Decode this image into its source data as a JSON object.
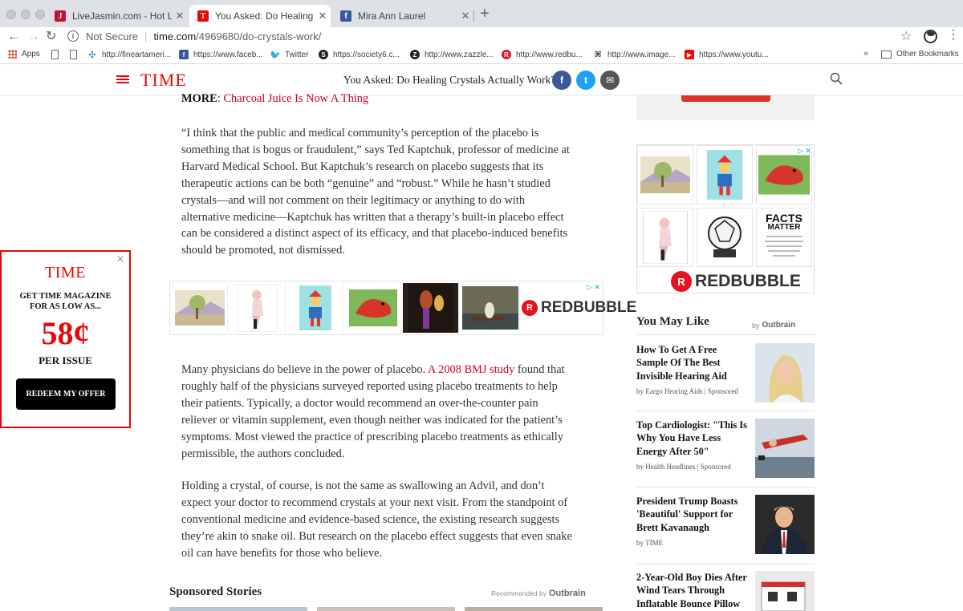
{
  "browser": {
    "tabs": [
      {
        "title": "LiveJasmin.com - Hot Live Sex",
        "favicon": "J",
        "favicon_color": "#c8102e"
      },
      {
        "title": "You Asked: Do Healing Crystals Actually Work?",
        "favicon": "T",
        "favicon_color": "#e90606"
      },
      {
        "title": "Mira Ann Laurel",
        "favicon": "f",
        "favicon_color": "#3b5998"
      }
    ],
    "url": {
      "security": "Not Secure",
      "host": "time.com",
      "path": "/4969680/do-crystals-work/"
    },
    "bookmarks": [
      {
        "label": "Apps",
        "icon": "apps-grid-icon"
      },
      {
        "label": "",
        "icon": "document-icon"
      },
      {
        "label": "",
        "icon": "document-icon"
      },
      {
        "label": "http://fineartameri...",
        "icon": "fineart-icon"
      },
      {
        "label": "https://www.faceb...",
        "icon": "facebook-icon"
      },
      {
        "label": "Twitter",
        "icon": "twitter-icon"
      },
      {
        "label": "https://society6.c...",
        "icon": "society6-icon"
      },
      {
        "label": "http://www.zazzle...",
        "icon": "zazzle-icon"
      },
      {
        "label": "http://www.redbu...",
        "icon": "redbubble-icon"
      },
      {
        "label": "http://www.image...",
        "icon": "imagekind-icon"
      },
      {
        "label": "https://www.youtu...",
        "icon": "youtube-icon"
      }
    ],
    "overflow": "»",
    "other_bookmarks": "Other Bookmarks"
  },
  "header": {
    "logo": "TIME",
    "title": "You Asked: Do Healing Crystals Actually Work?",
    "share": {
      "facebook": "f",
      "twitter": "t",
      "email": "✉"
    },
    "colors": {
      "facebook": "#3b5998",
      "twitter": "#1da1f2",
      "email": "#555555",
      "brand": "#e90606"
    }
  },
  "article": {
    "more_label": "MORE",
    "more_link": "Charcoal Juice Is Now A Thing",
    "p1": "“I think that the public and medical community’s perception of the placebo is something that is bogus or fraudulent,” says Ted Kaptchuk, professor of medicine at Harvard Medical School. But Kaptchuk’s research on placebo suggests that its therapeutic actions can be both “genuine” and “robust.” While he hasn’t studied crystals—and will not comment on their legitimacy or anything to do with alternative medicine—Kaptchuk has written that a therapy’s built-in placebo effect can be considered a distinct aspect of its efficacy, and that placebo-induced benefits should be promoted, not dismissed.",
    "p2_lead": "Many physicians do believe in the power of placebo. ",
    "p2_link": "A 2008 BMJ study",
    "p2_rest": " found that roughly half of the physicians surveyed reported using placebo treatments to help their patients. Typically, a doctor would recommend an over-the-counter pain reliever or vitamin supplement, even though neither was indicated for the patient’s symptoms. Most viewed the practice of prescribing placebo treatments as ethically permissible, the authors concluded.",
    "p3": "Holding a crystal, of course, is not the same as swallowing an Advil, and don’t expect your doctor to recommend crystals at your next visit. From the standpoint of conventional medicine and evidence-based science, the existing research suggests they’re akin to snake oil. But research on the placebo effect suggests that even snake oil can have benefits for those who believe.",
    "sponsored_title": "Sponsored Stories",
    "recommended_by": "Recommended by",
    "outbrain": "Outbrain"
  },
  "ads": {
    "redbubble": "REDBUBBLE",
    "redbubble_mark": "R",
    "adchoices": "▷ ✕",
    "facts_title": "FACTS",
    "facts_sub": "MATTER"
  },
  "promo": {
    "logo": "TIME",
    "line1": "GET TIME MAGAZINE",
    "line2": "FOR AS LOW AS...",
    "price": "58¢",
    "per_issue": "PER ISSUE",
    "button": "REDEEM MY OFFER",
    "close": "✕"
  },
  "sidebar": {
    "you_may_like": "You May Like",
    "by": "by",
    "outbrain": "Outbrain",
    "items": [
      {
        "title": "How To Get A Free Sample Of The Best Invisible Hearing Aid",
        "source": "by Eargo Hearing Aids | Sponsored"
      },
      {
        "title": "Top Cardiologist: \"This Is Why You Have Less Energy After 50\"",
        "source": "by Health Headlines | Sponsored"
      },
      {
        "title": "President Trump Boasts 'Beautiful' Support for Brett Kavanaugh",
        "source": "by TIME"
      },
      {
        "title": "2-Year-Old Boy Dies After Wind Tears Through Inflatable Bounce Pillow",
        "source": ""
      }
    ]
  }
}
